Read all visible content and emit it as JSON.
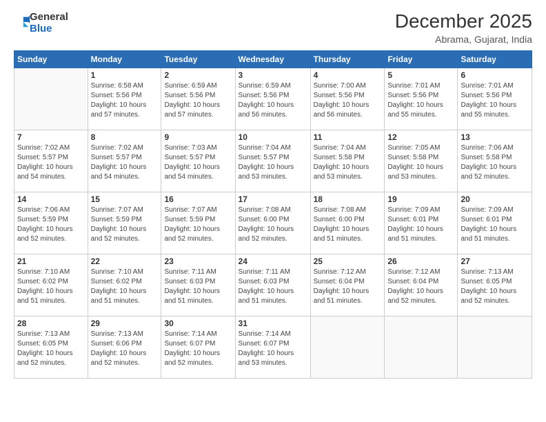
{
  "header": {
    "logo_general": "General",
    "logo_blue": "Blue",
    "title": "December 2025",
    "location": "Abrama, Gujarat, India"
  },
  "days_of_week": [
    "Sunday",
    "Monday",
    "Tuesday",
    "Wednesday",
    "Thursday",
    "Friday",
    "Saturday"
  ],
  "weeks": [
    [
      {
        "day": "",
        "info": ""
      },
      {
        "day": "1",
        "info": "Sunrise: 6:58 AM\nSunset: 5:56 PM\nDaylight: 10 hours\nand 57 minutes."
      },
      {
        "day": "2",
        "info": "Sunrise: 6:59 AM\nSunset: 5:56 PM\nDaylight: 10 hours\nand 57 minutes."
      },
      {
        "day": "3",
        "info": "Sunrise: 6:59 AM\nSunset: 5:56 PM\nDaylight: 10 hours\nand 56 minutes."
      },
      {
        "day": "4",
        "info": "Sunrise: 7:00 AM\nSunset: 5:56 PM\nDaylight: 10 hours\nand 56 minutes."
      },
      {
        "day": "5",
        "info": "Sunrise: 7:01 AM\nSunset: 5:56 PM\nDaylight: 10 hours\nand 55 minutes."
      },
      {
        "day": "6",
        "info": "Sunrise: 7:01 AM\nSunset: 5:56 PM\nDaylight: 10 hours\nand 55 minutes."
      }
    ],
    [
      {
        "day": "7",
        "info": "Sunrise: 7:02 AM\nSunset: 5:57 PM\nDaylight: 10 hours\nand 54 minutes."
      },
      {
        "day": "8",
        "info": "Sunrise: 7:02 AM\nSunset: 5:57 PM\nDaylight: 10 hours\nand 54 minutes."
      },
      {
        "day": "9",
        "info": "Sunrise: 7:03 AM\nSunset: 5:57 PM\nDaylight: 10 hours\nand 54 minutes."
      },
      {
        "day": "10",
        "info": "Sunrise: 7:04 AM\nSunset: 5:57 PM\nDaylight: 10 hours\nand 53 minutes."
      },
      {
        "day": "11",
        "info": "Sunrise: 7:04 AM\nSunset: 5:58 PM\nDaylight: 10 hours\nand 53 minutes."
      },
      {
        "day": "12",
        "info": "Sunrise: 7:05 AM\nSunset: 5:58 PM\nDaylight: 10 hours\nand 53 minutes."
      },
      {
        "day": "13",
        "info": "Sunrise: 7:06 AM\nSunset: 5:58 PM\nDaylight: 10 hours\nand 52 minutes."
      }
    ],
    [
      {
        "day": "14",
        "info": "Sunrise: 7:06 AM\nSunset: 5:59 PM\nDaylight: 10 hours\nand 52 minutes."
      },
      {
        "day": "15",
        "info": "Sunrise: 7:07 AM\nSunset: 5:59 PM\nDaylight: 10 hours\nand 52 minutes."
      },
      {
        "day": "16",
        "info": "Sunrise: 7:07 AM\nSunset: 5:59 PM\nDaylight: 10 hours\nand 52 minutes."
      },
      {
        "day": "17",
        "info": "Sunrise: 7:08 AM\nSunset: 6:00 PM\nDaylight: 10 hours\nand 52 minutes."
      },
      {
        "day": "18",
        "info": "Sunrise: 7:08 AM\nSunset: 6:00 PM\nDaylight: 10 hours\nand 51 minutes."
      },
      {
        "day": "19",
        "info": "Sunrise: 7:09 AM\nSunset: 6:01 PM\nDaylight: 10 hours\nand 51 minutes."
      },
      {
        "day": "20",
        "info": "Sunrise: 7:09 AM\nSunset: 6:01 PM\nDaylight: 10 hours\nand 51 minutes."
      }
    ],
    [
      {
        "day": "21",
        "info": "Sunrise: 7:10 AM\nSunset: 6:02 PM\nDaylight: 10 hours\nand 51 minutes."
      },
      {
        "day": "22",
        "info": "Sunrise: 7:10 AM\nSunset: 6:02 PM\nDaylight: 10 hours\nand 51 minutes."
      },
      {
        "day": "23",
        "info": "Sunrise: 7:11 AM\nSunset: 6:03 PM\nDaylight: 10 hours\nand 51 minutes."
      },
      {
        "day": "24",
        "info": "Sunrise: 7:11 AM\nSunset: 6:03 PM\nDaylight: 10 hours\nand 51 minutes."
      },
      {
        "day": "25",
        "info": "Sunrise: 7:12 AM\nSunset: 6:04 PM\nDaylight: 10 hours\nand 51 minutes."
      },
      {
        "day": "26",
        "info": "Sunrise: 7:12 AM\nSunset: 6:04 PM\nDaylight: 10 hours\nand 52 minutes."
      },
      {
        "day": "27",
        "info": "Sunrise: 7:13 AM\nSunset: 6:05 PM\nDaylight: 10 hours\nand 52 minutes."
      }
    ],
    [
      {
        "day": "28",
        "info": "Sunrise: 7:13 AM\nSunset: 6:05 PM\nDaylight: 10 hours\nand 52 minutes."
      },
      {
        "day": "29",
        "info": "Sunrise: 7:13 AM\nSunset: 6:06 PM\nDaylight: 10 hours\nand 52 minutes."
      },
      {
        "day": "30",
        "info": "Sunrise: 7:14 AM\nSunset: 6:07 PM\nDaylight: 10 hours\nand 52 minutes."
      },
      {
        "day": "31",
        "info": "Sunrise: 7:14 AM\nSunset: 6:07 PM\nDaylight: 10 hours\nand 53 minutes."
      },
      {
        "day": "",
        "info": ""
      },
      {
        "day": "",
        "info": ""
      },
      {
        "day": "",
        "info": ""
      }
    ]
  ]
}
